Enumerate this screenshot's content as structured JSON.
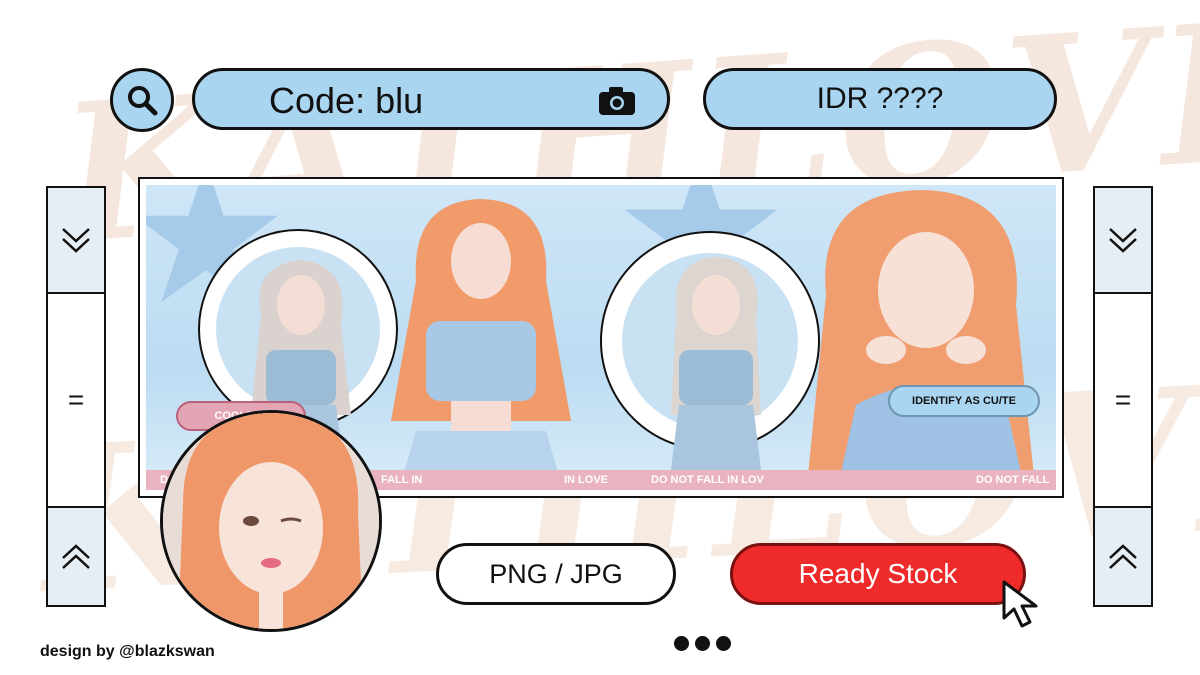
{
  "search": {
    "code_label": "Code: blu",
    "price_label": "IDR ????"
  },
  "banner": {
    "strip_texts": [
      "D",
      "FALL IN",
      "IN LOVE",
      "DO NOT FALL IN LOV",
      "DO NOT FALL"
    ],
    "tag_left": "COOLEST",
    "tag_right": "IDENTIFY AS CU/TE"
  },
  "buttons": {
    "format_label": "PNG / JPG",
    "stock_label": "Ready Stock"
  },
  "side_controls": {
    "middle_glyph": "="
  },
  "footer": {
    "credit": "design by @blazkswan"
  },
  "icons": [
    "search-icon",
    "camera-icon",
    "chevron-double-down-icon",
    "chevron-double-up-icon",
    "cursor-icon",
    "more-dots-icon"
  ],
  "colors": {
    "accent_blue": "#a9d5f0",
    "stock_red": "#ee2a2a",
    "strip_pink": "#e9b4bf",
    "watermark_peach": "#f4e3d8"
  }
}
